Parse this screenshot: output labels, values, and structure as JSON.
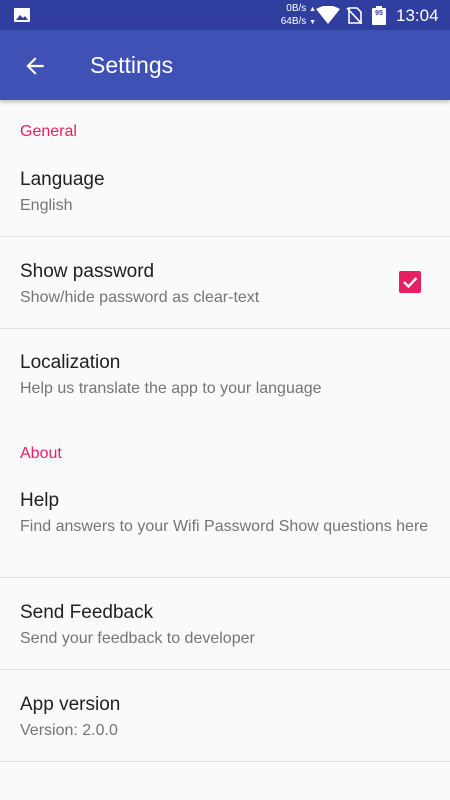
{
  "status_bar": {
    "net_down": "0B/s",
    "net_up": "64B/s",
    "battery_level": "95",
    "time": "13:04",
    "icons": [
      "gallery-icon",
      "wifi-icon",
      "no-sim-icon",
      "battery-icon"
    ]
  },
  "app_bar": {
    "title": "Settings",
    "back_icon": "arrow-back-icon"
  },
  "sections": {
    "general": "General",
    "about": "About"
  },
  "items": {
    "language": {
      "title": "Language",
      "summary": "English"
    },
    "show_password": {
      "title": "Show password",
      "summary": "Show/hide password as clear-text",
      "checked": true
    },
    "localization": {
      "title": "Localization",
      "summary": "Help us translate the app to your language"
    },
    "help": {
      "title": "Help",
      "summary": "Find answers to your Wifi Password Show questions here"
    },
    "feedback": {
      "title": "Send Feedback",
      "summary": "Send your feedback to developer"
    },
    "version": {
      "title": "App version",
      "summary": "Version: 2.0.0"
    }
  },
  "colors": {
    "status_bar": "#303f9f",
    "app_bar": "#3f51b5",
    "accent": "#e91e63"
  }
}
